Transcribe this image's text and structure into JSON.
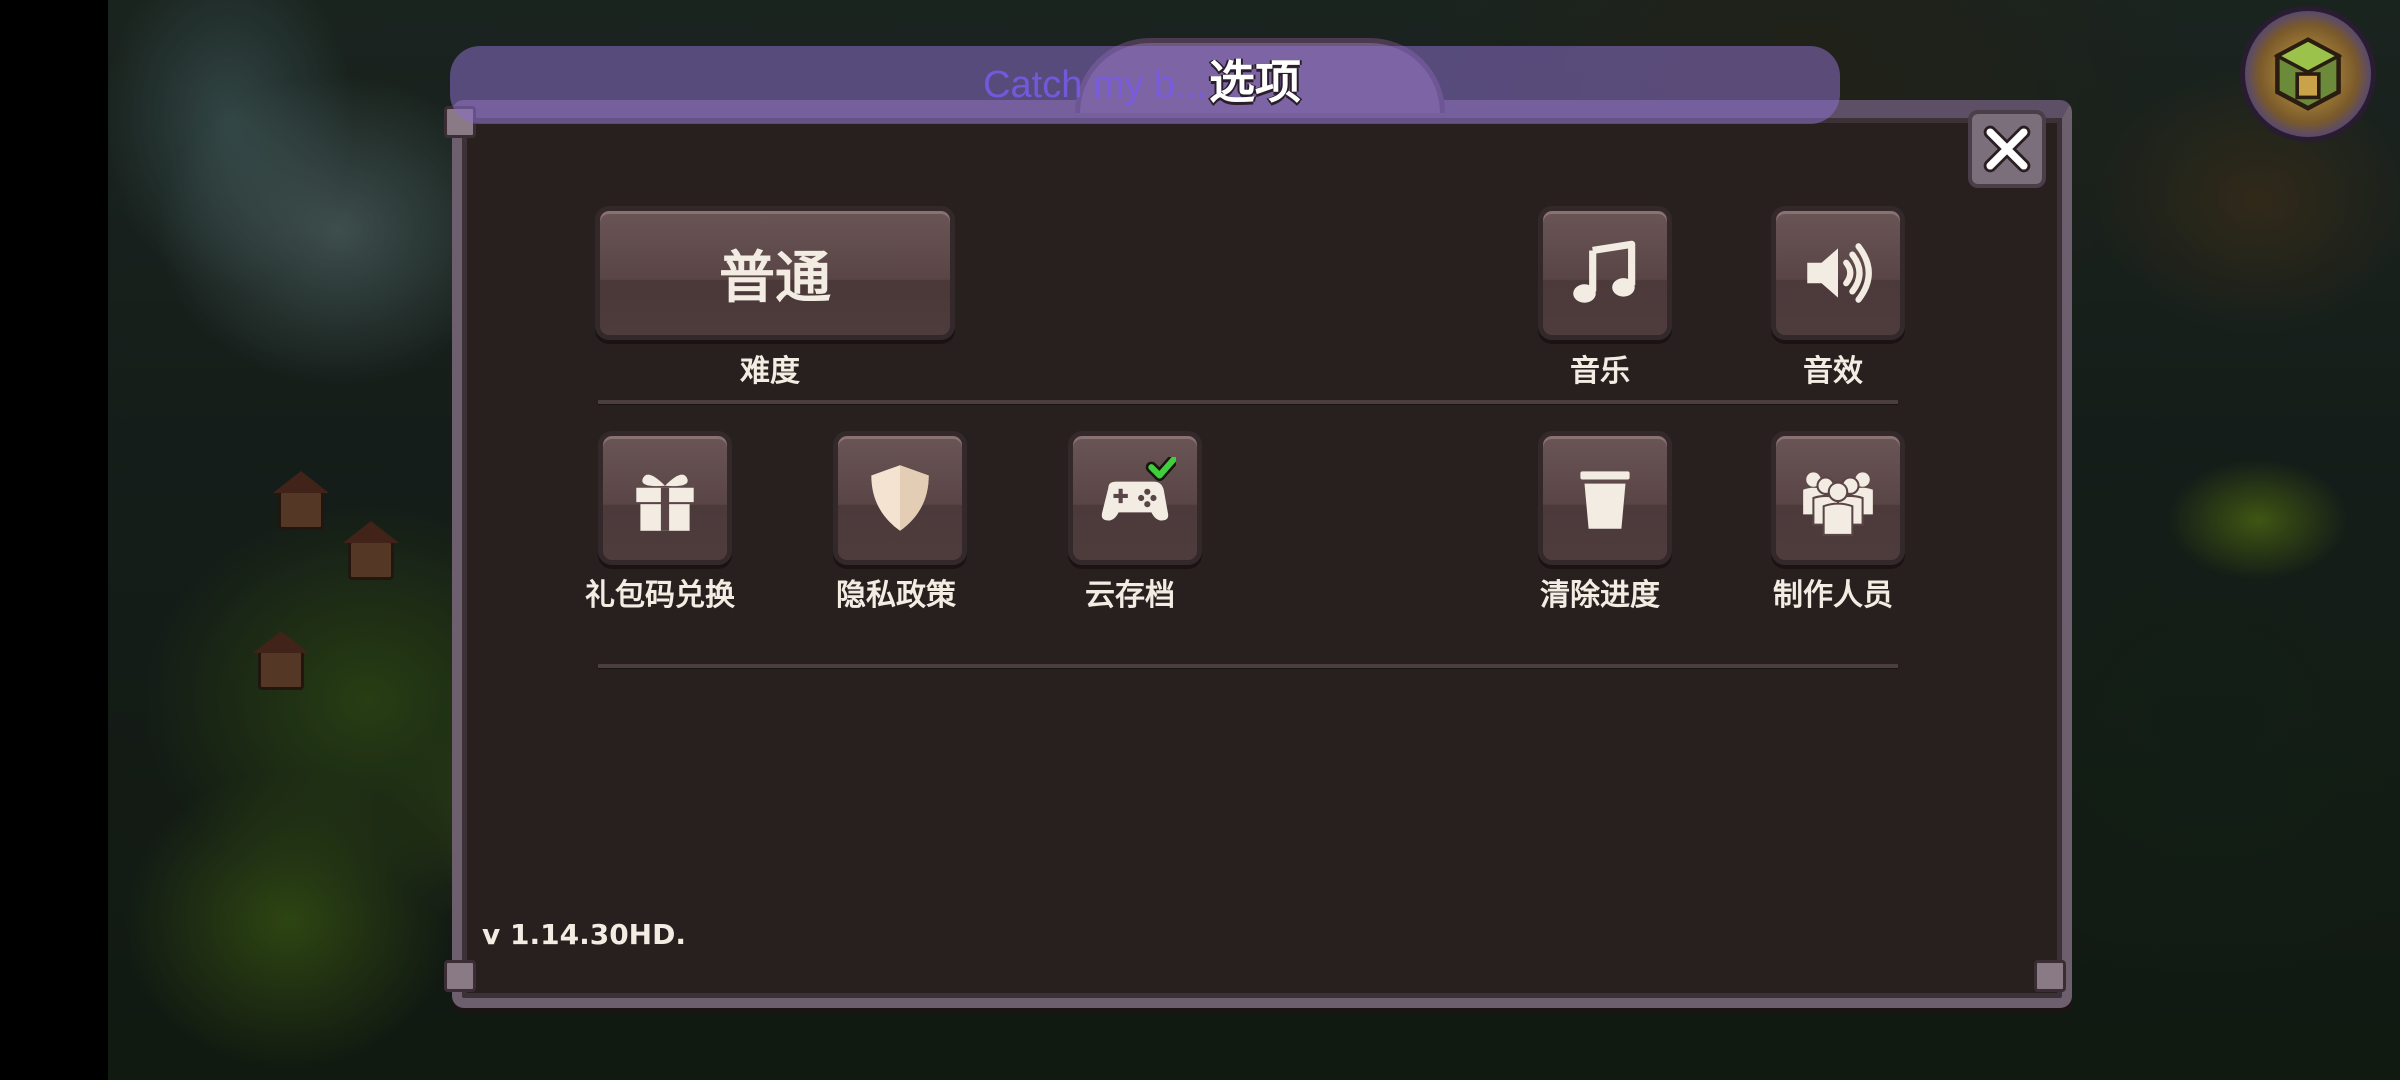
{
  "overlay": {
    "banner_text": "Catch my b..."
  },
  "dialog": {
    "title": "选项",
    "close_icon": "close-icon"
  },
  "difficulty": {
    "button_text": "普通",
    "label": "难度"
  },
  "audio": {
    "music_label": "音乐",
    "music_icon": "music-note-icon",
    "sfx_label": "音效",
    "sfx_icon": "speaker-icon"
  },
  "actions": [
    {
      "label": "礼包码兑换",
      "icon": "gift-icon"
    },
    {
      "label": "隐私政策",
      "icon": "shield-icon"
    },
    {
      "label": "云存档",
      "icon": "gamepad-check-icon"
    },
    {
      "label": "清除进度",
      "icon": "trash-icon"
    },
    {
      "label": "制作人员",
      "icon": "people-group-icon"
    }
  ],
  "version": "v 1.14.30HD.",
  "colors": {
    "panel": "#27201f",
    "button": "#5a4546",
    "text": "#f3ece3",
    "banner": "#8a6ec8",
    "check": "#3ecf3a"
  }
}
